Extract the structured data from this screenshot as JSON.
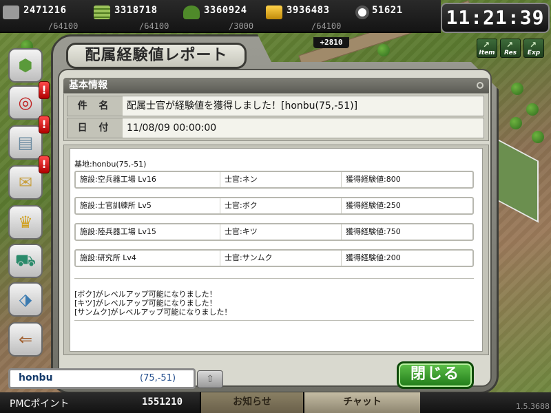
{
  "resources": [
    {
      "icon": "steel-icon",
      "amount": "2471216",
      "cap": "/64100"
    },
    {
      "icon": "fuel-icon",
      "amount": "3318718",
      "cap": "/64100"
    },
    {
      "icon": "soldier-icon",
      "amount": "3360924",
      "cap": "/3000"
    },
    {
      "icon": "gold-icon",
      "amount": "3936483",
      "cap": "/64100"
    },
    {
      "icon": "gear-icon",
      "amount": "51621",
      "cap": ""
    }
  ],
  "bonus": "+2810",
  "clock": "11:21:39",
  "mini_buttons": [
    "Item",
    "Res",
    "Exp"
  ],
  "sidebar": [
    {
      "icon": "map-icon"
    },
    {
      "icon": "target-icon"
    },
    {
      "icon": "documents-icon"
    },
    {
      "icon": "mail-icon"
    },
    {
      "icon": "ranking-icon"
    },
    {
      "icon": "cart-icon"
    },
    {
      "icon": "tag-icon"
    },
    {
      "icon": "exit-door-icon"
    }
  ],
  "dialog": {
    "title": "配属経験値レポート",
    "section": "基本情報",
    "subject_label": "件 名",
    "subject_value": "配属士官が経験値を獲得しました！[honbu(75,-51)]",
    "date_label": "日 付",
    "date_value": "11/08/09 00:00:00",
    "base_line": "基地:honbu(75,-51)",
    "facilities": [
      {
        "facility": "施設:空兵器工場 Lv16",
        "officer": "士官:ネン",
        "exp": "獲得経験値:800"
      },
      {
        "facility": "施設:士官訓練所 Lv5",
        "officer": "士官:ボク",
        "exp": "獲得経験値:250"
      },
      {
        "facility": "施設:陸兵器工場 Lv15",
        "officer": "士官:キツ",
        "exp": "獲得経験値:750"
      },
      {
        "facility": "施設:研究所 Lv4",
        "officer": "士官:サンムク",
        "exp": "獲得経験値:200"
      }
    ],
    "messages": [
      "[ボク]がレベルアップ可能になりました！",
      "[キツ]がレベルアップ可能になりました！",
      "[サンムク]がレベルアップ可能になりました！"
    ],
    "close_label": "閉じる"
  },
  "base_field": {
    "name": "honbu",
    "coords": "(75,-51)"
  },
  "bottom": {
    "pmc_label": "PMCポイント",
    "pmc_value": "1551210",
    "tab_notice": "お知らせ",
    "tab_chat": "チャット",
    "version": "1.5.3688"
  }
}
